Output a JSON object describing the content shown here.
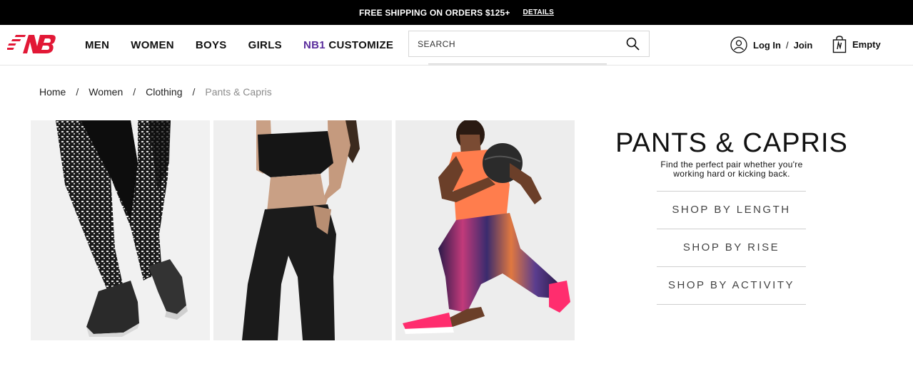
{
  "promo": {
    "message": "FREE SHIPPING ON ORDERS $125+",
    "details_link": "DETAILS"
  },
  "header": {
    "logo_icon": "new-balance-logo",
    "nav": [
      {
        "label": "MEN"
      },
      {
        "label": "WOMEN"
      },
      {
        "label": "BOYS"
      },
      {
        "label": "GIRLS"
      }
    ],
    "customize": {
      "prefix": "NB1",
      "label": "CUSTOMIZE",
      "prefix_color": "#5a2d9c"
    },
    "search": {
      "placeholder": "SEARCH",
      "value": "",
      "icon": "search-icon"
    },
    "account": {
      "login": "Log In",
      "separator": "/",
      "join": "Join",
      "icon": "user-icon"
    },
    "cart": {
      "label": "Empty",
      "icon": "shopping-bag-icon"
    }
  },
  "breadcrumb": {
    "items": [
      "Home",
      "Women",
      "Clothing",
      "Pants & Capris"
    ],
    "separator": "/"
  },
  "category": {
    "title": "PANTS & CAPRIS",
    "description": "Find the perfect pair whether you're working hard or kicking back.",
    "shop_links": [
      "SHOP BY LENGTH",
      "SHOP BY RISE",
      "SHOP BY ACTIVITY"
    ]
  },
  "colors": {
    "promo_bg": "#000000",
    "brand_red": "#e21836",
    "customize_purple": "#5a2d9c"
  }
}
